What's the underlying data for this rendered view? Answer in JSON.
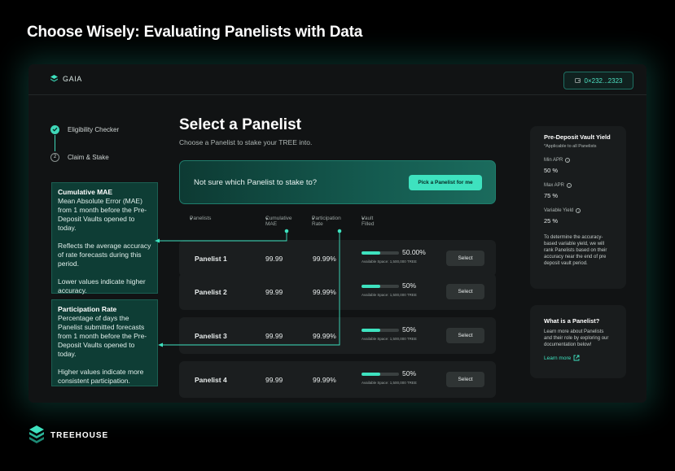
{
  "headline": "Choose Wisely: Evaluating Panelists with Data",
  "app": {
    "logo_text": "GAIA",
    "wallet": "0×232...2323"
  },
  "stepper": [
    {
      "label": "Eligibility Checker",
      "state": "done"
    },
    {
      "label": "Claim & Stake",
      "state": "current",
      "number": "2"
    }
  ],
  "main": {
    "title": "Select a Panelist",
    "subtitle": "Choose a Panelist to stake your TREE into.",
    "banner_text": "Not sure which Panelist to stake to?",
    "banner_button": "Pick a Panelist for me"
  },
  "table": {
    "headers": [
      "Panelists",
      "Cumulative MAE",
      "Participation Rate",
      "Vault Filled"
    ],
    "rows": [
      {
        "name": "Panelist 1",
        "mae": "99.99",
        "participation": "99.99%",
        "vault_pct_label": "50.00%",
        "vault_fraction": 0.5,
        "available": "Available Space: 1,500,000 TREE",
        "select": "Select"
      },
      {
        "name": "Panelist 2",
        "mae": "99.99",
        "participation": "99.99%",
        "vault_pct_label": "50%",
        "vault_fraction": 0.5,
        "available": "Available Space: 1,500,000 TREE",
        "select": "Select"
      },
      {
        "name": "Panelist 3",
        "mae": "99.99",
        "participation": "99.99%",
        "vault_pct_label": "50%",
        "vault_fraction": 0.5,
        "available": "Available Space: 1,500,000 TREE",
        "select": "Select"
      },
      {
        "name": "Panelist 4",
        "mae": "99.99",
        "participation": "99.99%",
        "vault_pct_label": "50%",
        "vault_fraction": 0.5,
        "available": "Available Space: 1,500,000 TREE",
        "select": "Select"
      }
    ]
  },
  "tooltips": {
    "mae": {
      "title": "Cumulative MAE",
      "lines": [
        "Mean Absolute Error (MAE) from 1 month before the Pre-Deposit Vaults opened to today.",
        "Reflects the average accuracy of rate forecasts during this period.",
        "Lower values indicate higher accuracy."
      ]
    },
    "participation": {
      "title": "Participation Rate",
      "lines": [
        "Percentage of days the Panelist submitted forecasts from 1 month before the Pre-Deposit Vaults opened to today.",
        "Higher values indicate more consistent participation."
      ]
    }
  },
  "yield_card": {
    "title": "Pre-Deposit Vault Yield",
    "note": "*Applicable to all Panelists",
    "min_apr_label": "Min APR",
    "min_apr_value": "50 %",
    "max_apr_label": "Max APR",
    "max_apr_value": "75 %",
    "variable_label": "Variable Yield",
    "variable_value": "25 %",
    "description": "To determine the accuracy-based variable yield, we will rank Panelists based on their accuracy near the end of pre deposit vault period."
  },
  "whatis_card": {
    "title": "What is a Panelist?",
    "body": "Learn more about Panelists and their role by exploring our documentation below!",
    "link": "Learn more"
  },
  "brand": "TREEHOUSE",
  "colors": {
    "accent": "#3ee2bf",
    "tooltip_bg": "#0e3d35",
    "app_bg": "#111314"
  }
}
